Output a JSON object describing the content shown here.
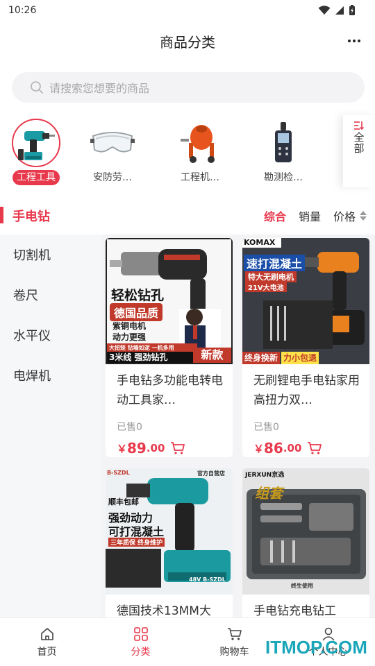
{
  "status_bar": {
    "time": "10:26"
  },
  "header": {
    "title": "商品分类"
  },
  "search": {
    "placeholder": "请搜索您想要的商品"
  },
  "categories": [
    {
      "label": "工程工具",
      "active": true,
      "icon": "drill-icon"
    },
    {
      "label": "安防劳…",
      "active": false,
      "icon": "goggles-icon"
    },
    {
      "label": "工程机…",
      "active": false,
      "icon": "cement-mixer-icon"
    },
    {
      "label": "勘测检…",
      "active": false,
      "icon": "detector-icon"
    }
  ],
  "all_button": {
    "label": "全部"
  },
  "sub_category": {
    "title": "手电钻"
  },
  "sort": {
    "default": "综合",
    "sales": "销量",
    "price": "价格"
  },
  "sidebar": {
    "items": [
      {
        "label": "切割机"
      },
      {
        "label": "卷尺"
      },
      {
        "label": "水平仪"
      },
      {
        "label": "电焊机"
      }
    ]
  },
  "products": [
    {
      "title": "手电钻多功能电转电动工具家…",
      "sold": "已售0",
      "price_symbol": "￥",
      "price_int": "89",
      "price_dec": ".00",
      "promo": {
        "headline": "轻松钻孔",
        "badge": "德国品质",
        "line1": "紫铜电机",
        "line2": "动力更强",
        "strip": "大扭矩  钻墙如泥  一机多用",
        "footer_left": "3米线  强劲钻孔",
        "footer_right": "新款"
      }
    },
    {
      "title": "无刷锂电手电钻家用高扭力双…",
      "sold": "已售0",
      "price_symbol": "￥",
      "price_int": "86",
      "price_dec": ".00",
      "promo": {
        "brand": "KOMAX",
        "headline": "速打混凝土",
        "badge": "特大无刷电机",
        "badge2": "21V大电池",
        "footer": "终身换新",
        "footer2": "力小包退"
      }
    },
    {
      "title": "德国技术13MM大",
      "promo": {
        "brand": "B-SZDL",
        "store": "官方自营店",
        "tag": "顺丰包邮",
        "headline1": "强劲动力",
        "headline2": "可打混凝土",
        "strip": "三年质保 终身维护",
        "battery": "48V B-SZDL"
      }
    },
    {
      "title": "手电钻充电钻工",
      "promo": {
        "brand": "JERXUN京选",
        "headline": "组套",
        "footer": "终生使用"
      }
    }
  ],
  "bottom_nav": [
    {
      "label": "首页",
      "icon": "home-icon",
      "active": false
    },
    {
      "label": "分类",
      "icon": "category-icon",
      "active": true
    },
    {
      "label": "购物车",
      "icon": "cart-icon",
      "active": false
    },
    {
      "label": "个人中心",
      "icon": "user-icon",
      "active": false
    }
  ],
  "watermark": "ITMOP.COM",
  "colors": {
    "accent": "#e8394c",
    "watermark": "#19a6b9"
  }
}
